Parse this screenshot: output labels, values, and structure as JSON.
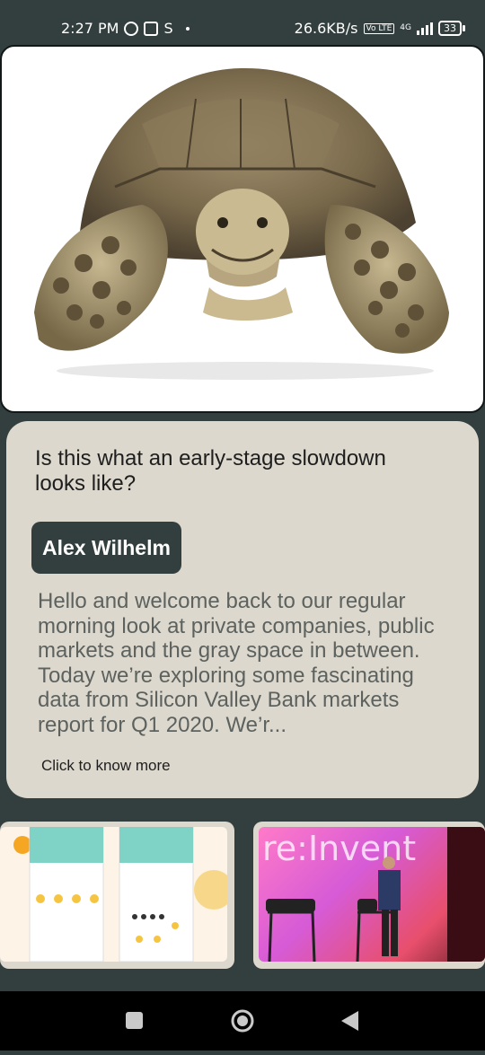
{
  "status_bar": {
    "time": "2:27 PM",
    "network_speed": "26.6KB/s",
    "network_type": "4G",
    "volte_badge": "Vo LTE",
    "battery": "33",
    "icons": [
      "whatsapp-icon",
      "gallery-icon",
      "sync-icon",
      "dot-icon",
      "signal-icon",
      "battery-icon"
    ]
  },
  "article": {
    "headline": "Is this what an early-stage slowdown looks like?",
    "author": "Alex Wilhelm",
    "excerpt": "Hello and welcome back to our regular morning look at private companies, public markets and the gray space in between. Today we’re exploring some fascinating data from Silicon Valley Bank markets report for Q1 2020. We’r...",
    "more_label": "Click to know more"
  },
  "thumbnails": {
    "second_overlay_text": "re:Invent"
  },
  "colors": {
    "background": "#333e3e",
    "card": "#dcd8cd",
    "chip": "#333e3e",
    "nav_bar": "#000000"
  },
  "nav_bar": {
    "icons": [
      "recents-square-icon",
      "home-circle-icon",
      "back-triangle-icon"
    ]
  }
}
